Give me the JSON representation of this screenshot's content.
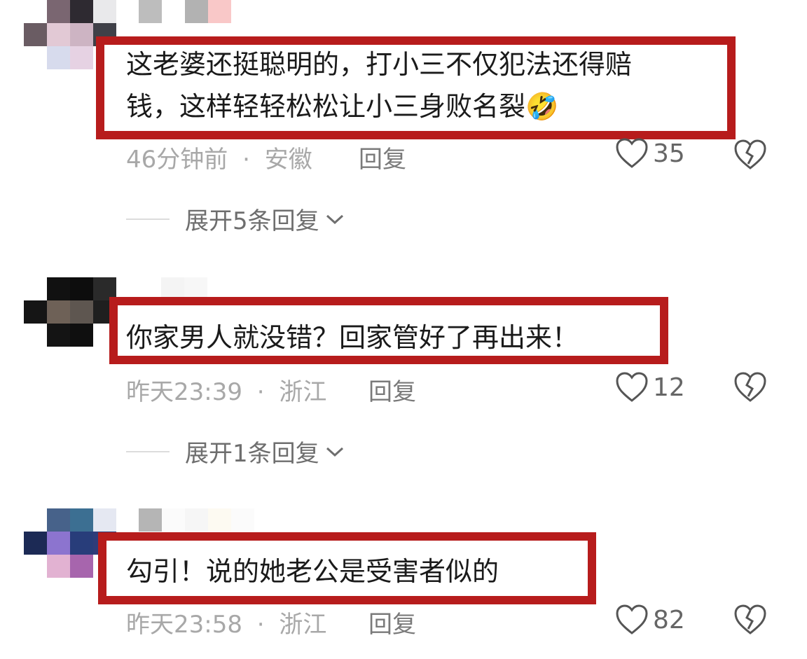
{
  "comments": [
    {
      "text_line1": "这老婆还挺聪明的，打小三不仅犯法还得赔",
      "text_line2": "钱，这样轻轻松松让小三身败名裂",
      "emoji": "🤣",
      "time": "46分钟前",
      "separator": "·",
      "location": "安徽",
      "reply_label": "回复",
      "likes": "35",
      "expand_label": "展开5条回复"
    },
    {
      "text_line1": "你家男人就没错？回家管好了再出来！",
      "time": "昨天23:39",
      "separator": "·",
      "location": "浙江",
      "reply_label": "回复",
      "likes": "12",
      "expand_label": "展开1条回复"
    },
    {
      "text_line1": "勾引！说的她老公是受害者似的",
      "time": "昨天23:58",
      "separator": "·",
      "location": "浙江",
      "reply_label": "回复",
      "likes": "82"
    }
  ],
  "colors": {
    "highlight_border": "#b71c1c",
    "text": "#1a1a1a",
    "meta": "#a8a8a8"
  }
}
